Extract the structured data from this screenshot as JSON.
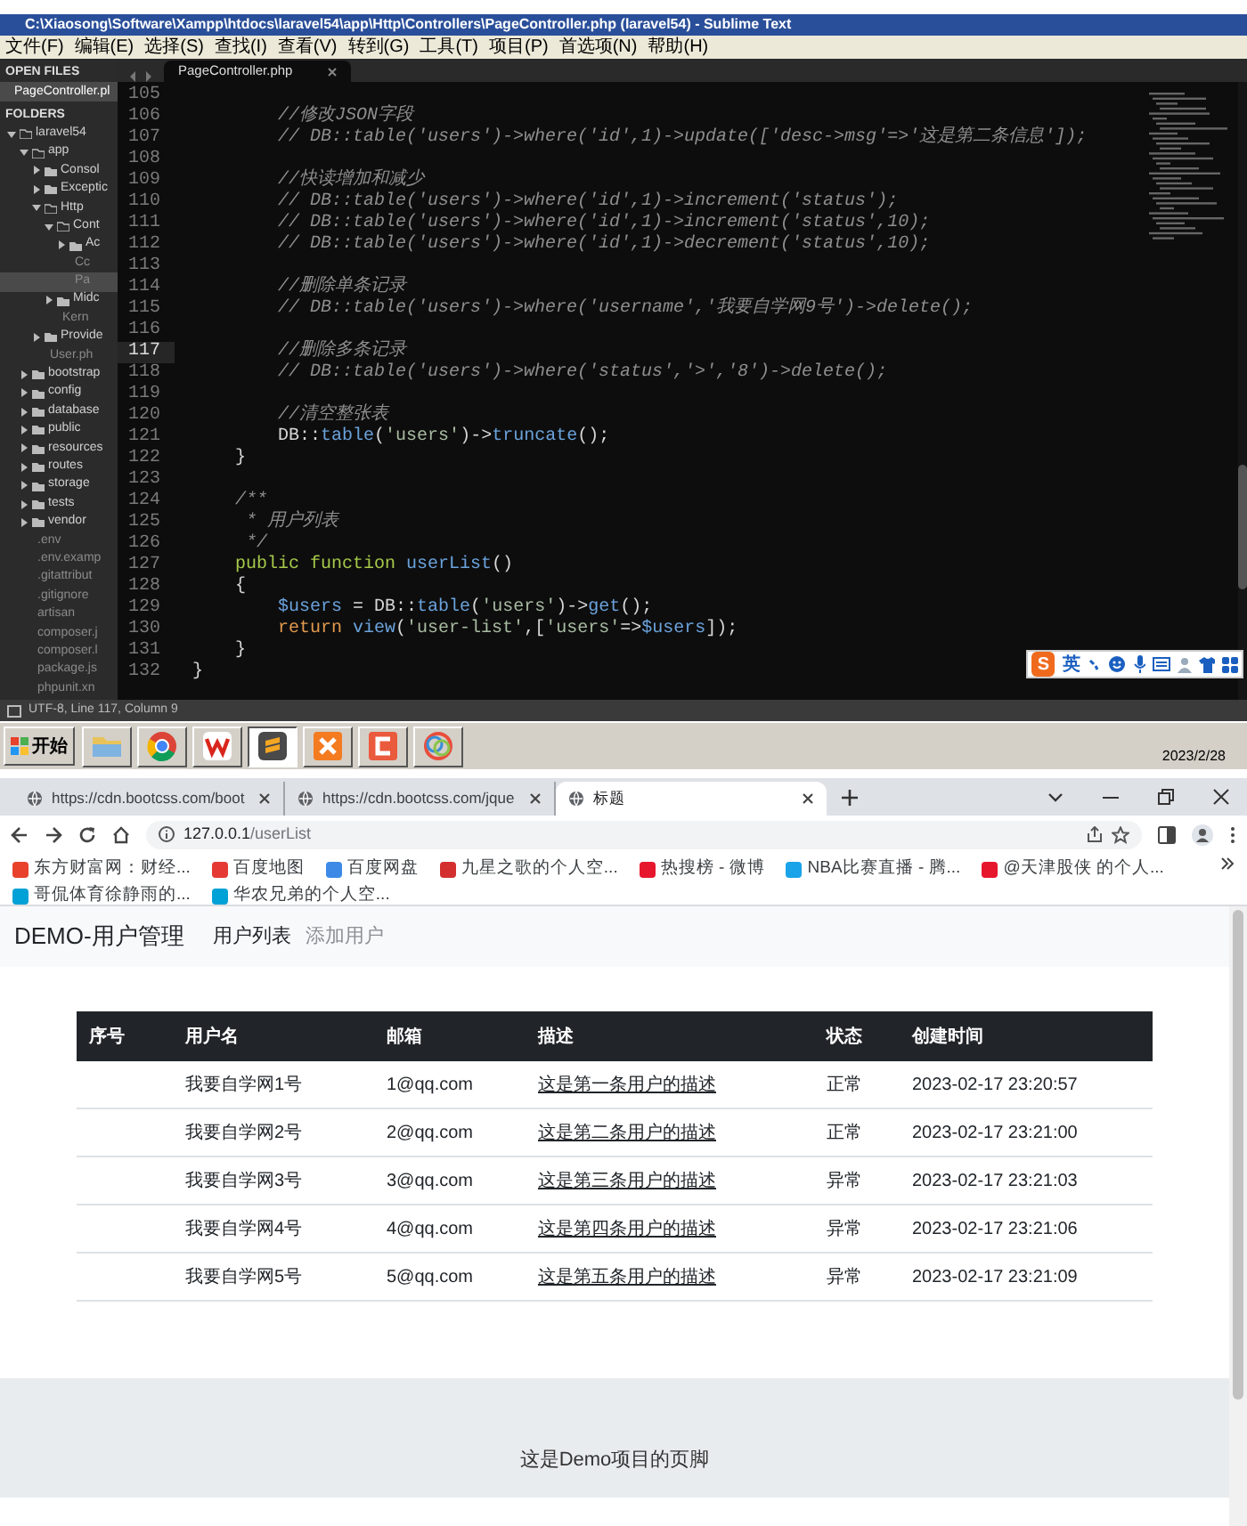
{
  "editor_window": {
    "title": "C:\\Xiaosong\\Software\\Xampp\\htdocs\\laravel54\\app\\Http\\Controllers\\PageController.php (laravel54) - Sublime Text",
    "menu": [
      "文件(F)",
      "编辑(E)",
      "选择(S)",
      "查找(I)",
      "查看(V)",
      "转到(G)",
      "工具(T)",
      "项目(P)",
      "首选项(N)",
      "帮助(H)"
    ],
    "sidebar": {
      "open_files_heading": "OPEN FILES",
      "open_files": [
        {
          "name": "PageController.pl",
          "selected": true
        }
      ],
      "folders_heading": "FOLDERS",
      "tree": [
        {
          "name": "laravel54",
          "kind": "folder",
          "expanded": true,
          "selected": false,
          "children": [
            {
              "name": "app",
              "kind": "folder",
              "expanded": true,
              "selected": false,
              "children": [
                {
                  "name": "Consol",
                  "kind": "folder",
                  "expanded": false,
                  "selected": false
                },
                {
                  "name": "Exceptic",
                  "kind": "folder",
                  "expanded": false,
                  "selected": false
                },
                {
                  "name": "Http",
                  "kind": "folder",
                  "expanded": true,
                  "selected": false,
                  "children": [
                    {
                      "name": "Cont",
                      "kind": "folder",
                      "expanded": true,
                      "selected": false,
                      "children": [
                        {
                          "name": "Ac",
                          "kind": "folder",
                          "expanded": false,
                          "selected": false
                        },
                        {
                          "name": "Cc",
                          "kind": "file",
                          "selected": false
                        },
                        {
                          "name": "Pa",
                          "kind": "file",
                          "selected": true
                        }
                      ]
                    },
                    {
                      "name": "Midc",
                      "kind": "folder",
                      "expanded": false,
                      "selected": false
                    },
                    {
                      "name": "Kern",
                      "kind": "file",
                      "selected": false
                    }
                  ]
                },
                {
                  "name": "Provide",
                  "kind": "folder",
                  "expanded": false,
                  "selected": false
                },
                {
                  "name": "User.ph",
                  "kind": "file",
                  "selected": false
                }
              ]
            },
            {
              "name": "bootstrap",
              "kind": "folder",
              "expanded": false,
              "selected": false
            },
            {
              "name": "config",
              "kind": "folder",
              "expanded": false,
              "selected": false
            },
            {
              "name": "database",
              "kind": "folder",
              "expanded": false,
              "selected": false
            },
            {
              "name": "public",
              "kind": "folder",
              "expanded": false,
              "selected": false
            },
            {
              "name": "resources",
              "kind": "folder",
              "expanded": false,
              "selected": false
            },
            {
              "name": "routes",
              "kind": "folder",
              "expanded": false,
              "selected": false
            },
            {
              "name": "storage",
              "kind": "folder",
              "expanded": false,
              "selected": false
            },
            {
              "name": "tests",
              "kind": "folder",
              "expanded": false,
              "selected": false
            },
            {
              "name": "vendor",
              "kind": "folder",
              "expanded": false,
              "selected": false
            },
            {
              "name": ".env",
              "kind": "file",
              "selected": false
            },
            {
              "name": ".env.examp",
              "kind": "file",
              "selected": false
            },
            {
              "name": ".gitattribut",
              "kind": "file",
              "selected": false
            },
            {
              "name": ".gitignore",
              "kind": "file",
              "selected": false
            },
            {
              "name": "artisan",
              "kind": "file",
              "selected": false
            },
            {
              "name": "composer.j",
              "kind": "file",
              "selected": false
            },
            {
              "name": "composer.l",
              "kind": "file",
              "selected": false
            },
            {
              "name": "package.js",
              "kind": "file",
              "selected": false
            },
            {
              "name": "phpunit.xn",
              "kind": "file",
              "selected": false
            }
          ]
        }
      ]
    },
    "tabs": [
      {
        "label": "PageController.php",
        "selected": true
      }
    ],
    "code_lines": [
      {
        "number": "105",
        "current": false
      },
      {
        "number": "106",
        "current": false,
        "segments": [
          {
            "kind": "comment",
            "text": "        //修改JSON字段"
          }
        ]
      },
      {
        "number": "107",
        "current": false,
        "segments": [
          {
            "kind": "comment",
            "text": "        // DB::table('users')->where('id',1)->update(['desc->msg'=>'这是第二条信息']);"
          }
        ]
      },
      {
        "number": "108",
        "current": false
      },
      {
        "number": "109",
        "current": false,
        "segments": [
          {
            "kind": "comment",
            "text": "        //快读增加和减少"
          }
        ]
      },
      {
        "number": "110",
        "current": false,
        "segments": [
          {
            "kind": "comment",
            "text": "        // DB::table('users')->where('id',1)->increment('status');"
          }
        ]
      },
      {
        "number": "111",
        "current": false,
        "segments": [
          {
            "kind": "comment",
            "text": "        // DB::table('users')->where('id',1)->increment('status',10);"
          }
        ]
      },
      {
        "number": "112",
        "current": false,
        "segments": [
          {
            "kind": "comment",
            "text": "        // DB::table('users')->where('id',1)->decrement('status',10);"
          }
        ]
      },
      {
        "number": "113",
        "current": false
      },
      {
        "number": "114",
        "current": false,
        "segments": [
          {
            "kind": "comment",
            "text": "        //删除单条记录"
          }
        ]
      },
      {
        "number": "115",
        "current": false,
        "segments": [
          {
            "kind": "comment",
            "text": "        // DB::table('users')->where('username','我要自学网9号')->delete();"
          }
        ]
      },
      {
        "number": "116",
        "current": false
      },
      {
        "number": "117",
        "current": true,
        "segments": [
          {
            "kind": "comment",
            "text": "        //删除多条记录"
          }
        ]
      },
      {
        "number": "118",
        "current": false,
        "segments": [
          {
            "kind": "comment",
            "text": "        // DB::table('users')->where('status','>','8')->delete();"
          }
        ]
      },
      {
        "number": "119",
        "current": false
      },
      {
        "number": "120",
        "current": false,
        "segments": [
          {
            "kind": "comment",
            "text": "        //清空整张表"
          }
        ]
      },
      {
        "number": "121",
        "current": false,
        "segments": [
          {
            "kind": "plain",
            "text": "        DB::"
          },
          {
            "kind": "function",
            "text": "table"
          },
          {
            "kind": "plain",
            "text": "("
          },
          {
            "kind": "string",
            "text": "'users'"
          },
          {
            "kind": "plain",
            "text": ")->"
          },
          {
            "kind": "function",
            "text": "truncate"
          },
          {
            "kind": "plain",
            "text": "();"
          }
        ]
      },
      {
        "number": "122",
        "current": false,
        "segments": [
          {
            "kind": "plain",
            "text": "    }"
          }
        ]
      },
      {
        "number": "123",
        "current": false
      },
      {
        "number": "124",
        "current": false,
        "segments": [
          {
            "kind": "comment",
            "text": "    /**"
          }
        ]
      },
      {
        "number": "125",
        "current": false,
        "segments": [
          {
            "kind": "comment",
            "text": "     * 用户列表"
          }
        ]
      },
      {
        "number": "126",
        "current": false,
        "segments": [
          {
            "kind": "comment",
            "text": "     */"
          }
        ]
      },
      {
        "number": "127",
        "current": false,
        "segments": [
          {
            "kind": "keyword",
            "text": "    public function"
          },
          {
            "kind": "function",
            "text": " userList"
          },
          {
            "kind": "plain",
            "text": "()"
          }
        ]
      },
      {
        "number": "128",
        "current": false,
        "segments": [
          {
            "kind": "plain",
            "text": "    {"
          }
        ]
      },
      {
        "number": "129",
        "current": false,
        "segments": [
          {
            "kind": "variable",
            "text": "        $users"
          },
          {
            "kind": "plain",
            "text": " = DB::"
          },
          {
            "kind": "function",
            "text": "table"
          },
          {
            "kind": "plain",
            "text": "("
          },
          {
            "kind": "string",
            "text": "'users'"
          },
          {
            "kind": "plain",
            "text": ")->"
          },
          {
            "kind": "function",
            "text": "get"
          },
          {
            "kind": "plain",
            "text": "();"
          }
        ]
      },
      {
        "number": "130",
        "current": false,
        "segments": [
          {
            "kind": "storage",
            "text": "        return"
          },
          {
            "kind": "function",
            "text": " view"
          },
          {
            "kind": "plain",
            "text": "("
          },
          {
            "kind": "string",
            "text": "'user-list'"
          },
          {
            "kind": "plain",
            "text": ",["
          },
          {
            "kind": "string",
            "text": "'users'"
          },
          {
            "kind": "plain",
            "text": "=>"
          },
          {
            "kind": "variable",
            "text": "$users"
          },
          {
            "kind": "plain",
            "text": "]);"
          }
        ]
      },
      {
        "number": "131",
        "current": false,
        "segments": [
          {
            "kind": "plain",
            "text": "    }"
          }
        ]
      },
      {
        "number": "132",
        "current": false,
        "segments": [
          {
            "kind": "plain",
            "text": "}"
          }
        ]
      }
    ],
    "status_bar": "UTF-8, Line 117, Column 9"
  },
  "ime_toolbar": {
    "logo": "S",
    "mode": "英"
  },
  "taskbar": {
    "start_label": "开始",
    "apps": [
      {
        "kind": "folder",
        "selected": false
      },
      {
        "kind": "chrome",
        "selected": false
      },
      {
        "kind": "wps",
        "selected": false
      },
      {
        "kind": "sublime",
        "selected": true
      },
      {
        "kind": "xampp",
        "selected": false
      },
      {
        "kind": "c-app",
        "selected": false
      },
      {
        "kind": "ring-app",
        "selected": false
      }
    ],
    "date": "2023/2/28"
  },
  "browser": {
    "tabs": [
      {
        "label": "https://cdn.bootcss.com/boot",
        "selected": false
      },
      {
        "label": "https://cdn.bootcss.com/jque",
        "selected": false
      },
      {
        "label": "标题",
        "selected": true
      }
    ],
    "address": {
      "host": "127.0.0.1",
      "path": "/userList"
    },
    "bookmarks": [
      {
        "label": "东方财富网：财经...",
        "color": "#e8412c"
      },
      {
        "label": "百度地图",
        "color": "#e53935"
      },
      {
        "label": "百度网盘",
        "color": "#3d8ae6"
      },
      {
        "label": "九星之歌的个人空...",
        "color": "#d32f2f"
      },
      {
        "label": "热搜榜 - 微博",
        "color": "#e6162d"
      },
      {
        "label": "NBA比赛直播 - 腾...",
        "color": "#1aa3e8"
      },
      {
        "label": "@天津股侠 的个人...",
        "color": "#e6162d"
      },
      {
        "label": "哥侃体育徐静雨的...",
        "color": "#00a1d6"
      },
      {
        "label": "华农兄弟的个人空...",
        "color": "#00a1d6"
      }
    ],
    "page": {
      "brand": "DEMO-用户管理",
      "nav": [
        {
          "label": "用户列表",
          "selected": true
        },
        {
          "label": "添加用户",
          "selected": false
        }
      ],
      "table": {
        "columns": [
          "序号",
          "用户名",
          "邮箱",
          "描述",
          "状态",
          "创建时间"
        ],
        "rows": [
          {
            "username": "我要自学网1号",
            "email": "1@qq.com",
            "description": "这是第一条用户的描述",
            "status": "正常",
            "created_at": "2023-02-17 23:20:57"
          },
          {
            "username": "我要自学网2号",
            "email": "2@qq.com",
            "description": "这是第二条用户的描述",
            "status": "正常",
            "created_at": "2023-02-17 23:21:00"
          },
          {
            "username": "我要自学网3号",
            "email": "3@qq.com",
            "description": "这是第三条用户的描述",
            "status": "异常",
            "created_at": "2023-02-17 23:21:03"
          },
          {
            "username": "我要自学网4号",
            "email": "4@qq.com",
            "description": "这是第四条用户的描述",
            "status": "异常",
            "created_at": "2023-02-17 23:21:06"
          },
          {
            "username": "我要自学网5号",
            "email": "5@qq.com",
            "description": "这是第五条用户的描述",
            "status": "异常",
            "created_at": "2023-02-17 23:21:09"
          }
        ]
      },
      "footer": "这是Demo项目的页脚"
    }
  }
}
